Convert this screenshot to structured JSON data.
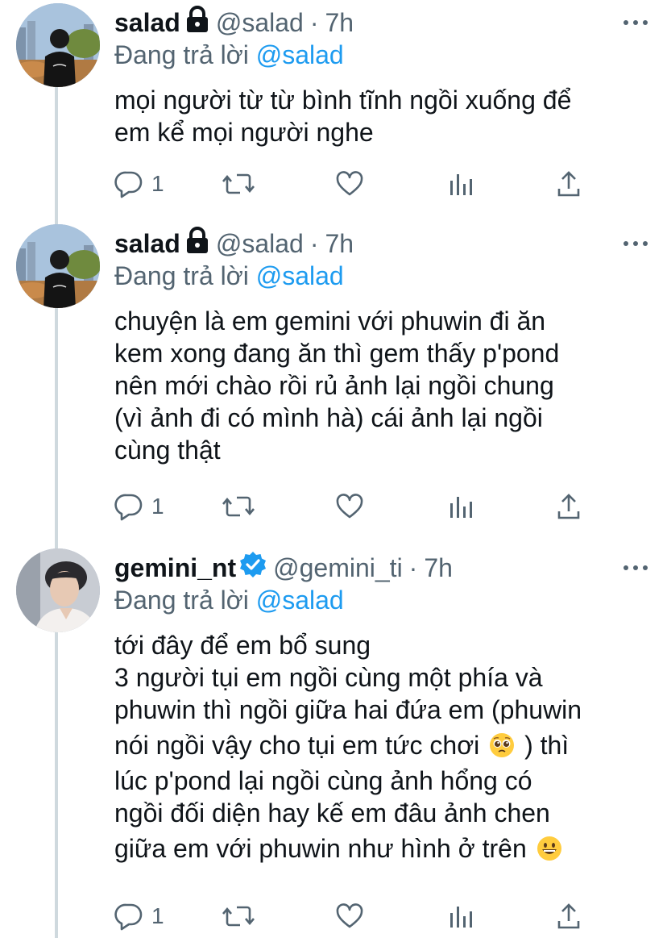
{
  "tweets": [
    {
      "display_name": "salad",
      "handle": "@salad",
      "separator": "·",
      "time": "7h",
      "reply_prefix": "Đang trả lời",
      "reply_mention": "@salad",
      "lines": [
        "mọi người từ từ bình tĩnh ngồi xuống để",
        "em kể mọi người nghe"
      ],
      "actions": {
        "reply_count": "1",
        "retweet_count": "",
        "like_count": ""
      }
    },
    {
      "display_name": "salad",
      "handle": "@salad",
      "separator": "·",
      "time": "7h",
      "reply_prefix": "Đang trả lời",
      "reply_mention": "@salad",
      "lines": [
        "chuyện là em gemini với phuwin đi ăn",
        "kem xong đang ăn thì gem thấy p'pond",
        "nên mới chào rồi rủ ảnh lại ngồi chung",
        "(vì ảnh đi có mình hà) cái ảnh lại ngồi",
        "cùng thật"
      ],
      "actions": {
        "reply_count": "1",
        "retweet_count": "",
        "like_count": ""
      }
    },
    {
      "display_name": "gemini_nt",
      "handle": "@gemini_ti",
      "separator": "·",
      "time": "7h",
      "reply_prefix": "Đang trả lời",
      "reply_mention": "@salad",
      "lines": [
        "tới đây để em bổ sung",
        "3 người tụi em ngồi cùng một phía và",
        "phuwin thì ngồi giữa hai đứa em (phuwin",
        "nói ngồi vậy cho tụi em tức chơi",
        ") thì",
        "lúc p'pond lại ngồi cùng ảnh hổng có",
        "ngồi đối diện hay kế em đâu ảnh chen",
        "giữa em với phuwin như hình ở trên"
      ],
      "actions": {
        "reply_count": "1",
        "retweet_count": "",
        "like_count": ""
      }
    }
  ],
  "icons": {
    "lock": "lock-icon",
    "verified": "verified-badge-icon",
    "more": "more-options-icon",
    "reply": "reply-icon",
    "retweet": "retweet-icon",
    "like": "like-icon",
    "analytics": "analytics-icon",
    "share": "share-icon",
    "emoji_1": "pleading-face-emoji",
    "emoji_2": "grinning-face-emoji"
  },
  "colors": {
    "text": "#0f1419",
    "secondary": "#536471",
    "link": "#1d9bf0",
    "verified": "#1d9bf0",
    "thread_line": "#cfd9de"
  }
}
